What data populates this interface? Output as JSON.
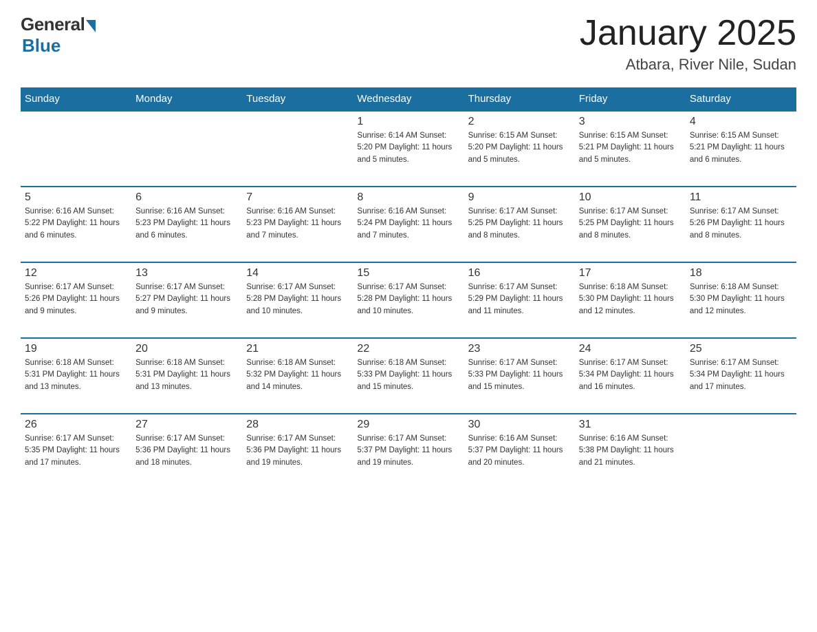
{
  "logo": {
    "general": "General",
    "blue": "Blue"
  },
  "header": {
    "month": "January 2025",
    "location": "Atbara, River Nile, Sudan"
  },
  "weekdays": [
    "Sunday",
    "Monday",
    "Tuesday",
    "Wednesday",
    "Thursday",
    "Friday",
    "Saturday"
  ],
  "weeks": [
    [
      {
        "day": "",
        "info": ""
      },
      {
        "day": "",
        "info": ""
      },
      {
        "day": "",
        "info": ""
      },
      {
        "day": "1",
        "info": "Sunrise: 6:14 AM\nSunset: 5:20 PM\nDaylight: 11 hours\nand 5 minutes."
      },
      {
        "day": "2",
        "info": "Sunrise: 6:15 AM\nSunset: 5:20 PM\nDaylight: 11 hours\nand 5 minutes."
      },
      {
        "day": "3",
        "info": "Sunrise: 6:15 AM\nSunset: 5:21 PM\nDaylight: 11 hours\nand 5 minutes."
      },
      {
        "day": "4",
        "info": "Sunrise: 6:15 AM\nSunset: 5:21 PM\nDaylight: 11 hours\nand 6 minutes."
      }
    ],
    [
      {
        "day": "5",
        "info": "Sunrise: 6:16 AM\nSunset: 5:22 PM\nDaylight: 11 hours\nand 6 minutes."
      },
      {
        "day": "6",
        "info": "Sunrise: 6:16 AM\nSunset: 5:23 PM\nDaylight: 11 hours\nand 6 minutes."
      },
      {
        "day": "7",
        "info": "Sunrise: 6:16 AM\nSunset: 5:23 PM\nDaylight: 11 hours\nand 7 minutes."
      },
      {
        "day": "8",
        "info": "Sunrise: 6:16 AM\nSunset: 5:24 PM\nDaylight: 11 hours\nand 7 minutes."
      },
      {
        "day": "9",
        "info": "Sunrise: 6:17 AM\nSunset: 5:25 PM\nDaylight: 11 hours\nand 8 minutes."
      },
      {
        "day": "10",
        "info": "Sunrise: 6:17 AM\nSunset: 5:25 PM\nDaylight: 11 hours\nand 8 minutes."
      },
      {
        "day": "11",
        "info": "Sunrise: 6:17 AM\nSunset: 5:26 PM\nDaylight: 11 hours\nand 8 minutes."
      }
    ],
    [
      {
        "day": "12",
        "info": "Sunrise: 6:17 AM\nSunset: 5:26 PM\nDaylight: 11 hours\nand 9 minutes."
      },
      {
        "day": "13",
        "info": "Sunrise: 6:17 AM\nSunset: 5:27 PM\nDaylight: 11 hours\nand 9 minutes."
      },
      {
        "day": "14",
        "info": "Sunrise: 6:17 AM\nSunset: 5:28 PM\nDaylight: 11 hours\nand 10 minutes."
      },
      {
        "day": "15",
        "info": "Sunrise: 6:17 AM\nSunset: 5:28 PM\nDaylight: 11 hours\nand 10 minutes."
      },
      {
        "day": "16",
        "info": "Sunrise: 6:17 AM\nSunset: 5:29 PM\nDaylight: 11 hours\nand 11 minutes."
      },
      {
        "day": "17",
        "info": "Sunrise: 6:18 AM\nSunset: 5:30 PM\nDaylight: 11 hours\nand 12 minutes."
      },
      {
        "day": "18",
        "info": "Sunrise: 6:18 AM\nSunset: 5:30 PM\nDaylight: 11 hours\nand 12 minutes."
      }
    ],
    [
      {
        "day": "19",
        "info": "Sunrise: 6:18 AM\nSunset: 5:31 PM\nDaylight: 11 hours\nand 13 minutes."
      },
      {
        "day": "20",
        "info": "Sunrise: 6:18 AM\nSunset: 5:31 PM\nDaylight: 11 hours\nand 13 minutes."
      },
      {
        "day": "21",
        "info": "Sunrise: 6:18 AM\nSunset: 5:32 PM\nDaylight: 11 hours\nand 14 minutes."
      },
      {
        "day": "22",
        "info": "Sunrise: 6:18 AM\nSunset: 5:33 PM\nDaylight: 11 hours\nand 15 minutes."
      },
      {
        "day": "23",
        "info": "Sunrise: 6:17 AM\nSunset: 5:33 PM\nDaylight: 11 hours\nand 15 minutes."
      },
      {
        "day": "24",
        "info": "Sunrise: 6:17 AM\nSunset: 5:34 PM\nDaylight: 11 hours\nand 16 minutes."
      },
      {
        "day": "25",
        "info": "Sunrise: 6:17 AM\nSunset: 5:34 PM\nDaylight: 11 hours\nand 17 minutes."
      }
    ],
    [
      {
        "day": "26",
        "info": "Sunrise: 6:17 AM\nSunset: 5:35 PM\nDaylight: 11 hours\nand 17 minutes."
      },
      {
        "day": "27",
        "info": "Sunrise: 6:17 AM\nSunset: 5:36 PM\nDaylight: 11 hours\nand 18 minutes."
      },
      {
        "day": "28",
        "info": "Sunrise: 6:17 AM\nSunset: 5:36 PM\nDaylight: 11 hours\nand 19 minutes."
      },
      {
        "day": "29",
        "info": "Sunrise: 6:17 AM\nSunset: 5:37 PM\nDaylight: 11 hours\nand 19 minutes."
      },
      {
        "day": "30",
        "info": "Sunrise: 6:16 AM\nSunset: 5:37 PM\nDaylight: 11 hours\nand 20 minutes."
      },
      {
        "day": "31",
        "info": "Sunrise: 6:16 AM\nSunset: 5:38 PM\nDaylight: 11 hours\nand 21 minutes."
      },
      {
        "day": "",
        "info": ""
      }
    ]
  ]
}
